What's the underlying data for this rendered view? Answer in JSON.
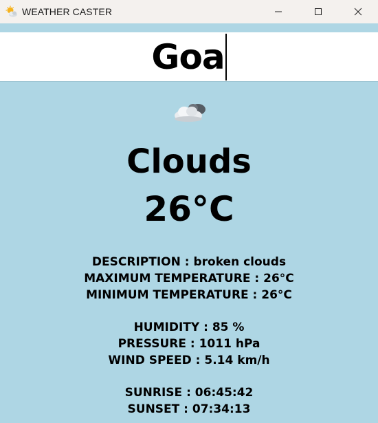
{
  "window": {
    "title": "WEATHER CASTER",
    "icon": "weather-app-icon",
    "controls": [
      "minimize-icon",
      "maximize-icon",
      "close-icon"
    ]
  },
  "search": {
    "value": "Goa"
  },
  "weather": {
    "icon": "cloud-icon",
    "condition": "Clouds",
    "temperature": "26°C"
  },
  "details": {
    "description": "DESCRIPTION : broken clouds",
    "max_temp": "MAXIMUM TEMPERATURE : 26°C",
    "min_temp": "MINIMUM TEMPERATURE : 26°C",
    "humidity": "HUMIDITY : 85 %",
    "pressure": "PRESSURE : 1011 hPa",
    "wind_speed": "WIND SPEED : 5.14 km/h",
    "sunrise": "SUNRISE : 06:45:42",
    "sunset": "SUNSET : 07:34:13"
  },
  "colors": {
    "background": "#aed6e4",
    "titlebar": "#f4f1ee",
    "text": "#000000"
  }
}
